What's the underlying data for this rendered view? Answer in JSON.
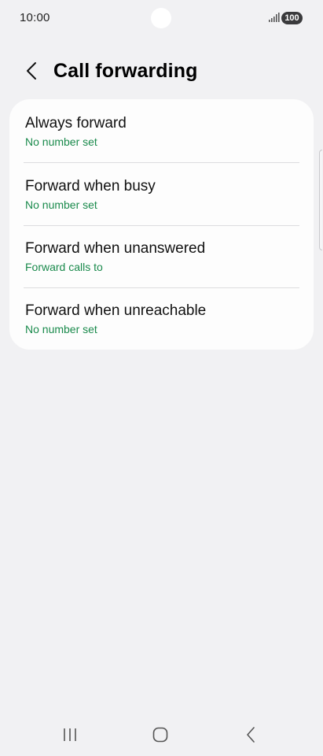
{
  "status_bar": {
    "time": "10:00",
    "battery": "100",
    "signal_icon": "signal-bars-icon"
  },
  "header": {
    "back_icon": "chevron-left-icon",
    "title": "Call forwarding"
  },
  "items": [
    {
      "title": "Always forward",
      "subtitle": "No number set"
    },
    {
      "title": "Forward when busy",
      "subtitle": "No number set"
    },
    {
      "title": "Forward when unanswered",
      "subtitle": "Forward calls to"
    },
    {
      "title": "Forward when unreachable",
      "subtitle": "No number set"
    }
  ],
  "colors": {
    "background": "#f1f1f3",
    "card": "#fdfdfd",
    "accent_green": "#1a8a4c",
    "divider": "#dcdcdf"
  },
  "nav_bar": {
    "recents_icon": "recent-apps-icon",
    "home_icon": "home-icon",
    "back_icon": "back-icon"
  }
}
